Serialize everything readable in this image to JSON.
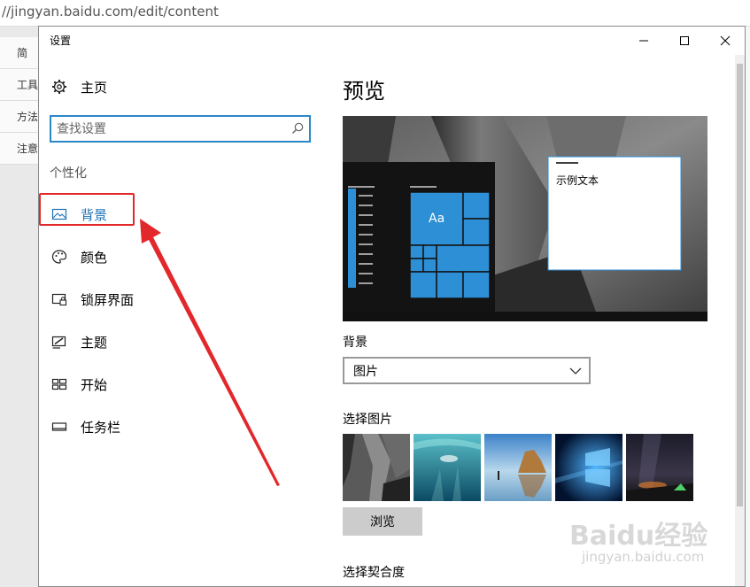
{
  "background_page": {
    "url_text": "//jingyan.baidu.com/edit/content",
    "side_items": [
      "简",
      "工具",
      "方法",
      "注意"
    ]
  },
  "window": {
    "title": "设置",
    "controls": {
      "minimize": "minimize-icon",
      "maximize": "maximize-icon",
      "close": "close-icon"
    }
  },
  "nav": {
    "home_label": "主页",
    "search_placeholder": "查找设置",
    "section_label": "个性化",
    "items": [
      {
        "label": "背景",
        "icon": "picture-icon",
        "active": true
      },
      {
        "label": "颜色",
        "icon": "palette-icon",
        "active": false
      },
      {
        "label": "锁屏界面",
        "icon": "lock-screen-icon",
        "active": false
      },
      {
        "label": "主题",
        "icon": "theme-icon",
        "active": false
      },
      {
        "label": "开始",
        "icon": "start-icon",
        "active": false
      },
      {
        "label": "任务栏",
        "icon": "taskbar-icon",
        "active": false
      }
    ]
  },
  "content": {
    "preview_title": "预览",
    "preview_tile_text": "Aa",
    "preview_window_text": "示例文本",
    "background_label": "背景",
    "background_value": "图片",
    "choose_picture_label": "选择图片",
    "browse_label": "浏览",
    "choose_fit_label": "选择契合度"
  },
  "watermark": {
    "main": "Baidu经验",
    "sub": "jingyan.baidu.com"
  },
  "colors": {
    "accent": "#1e73b8",
    "tile_blue": "#2d8fd5",
    "annotation_red": "#e3282c"
  }
}
